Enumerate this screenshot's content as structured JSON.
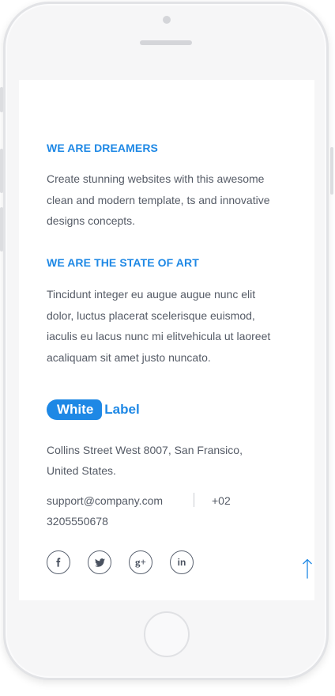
{
  "sections": [
    {
      "heading": "WE ARE DREAMERS",
      "body": "Create stunning websites with this awesome clean and modern template, ts and innovative designs concepts."
    },
    {
      "heading": "WE ARE THE STATE OF ART",
      "body": "Tincidunt integer eu augue augue nunc elit dolor, luctus placerat scelerisque euismod, iaculis eu lacus nunc mi elitvehicula ut laoreet acaliquam sit amet justo nuncato."
    }
  ],
  "brand": {
    "pill_text": "White",
    "label_text": "Label"
  },
  "contact": {
    "address_line1": "Collins Street West 8007, San Fransico,",
    "address_line2": "United States.",
    "email": "support@company.com",
    "phone_prefix": "+02",
    "phone_number": "3205550678"
  },
  "social": [
    {
      "icon": "facebook-icon",
      "glyph": "f"
    },
    {
      "icon": "twitter-icon",
      "glyph": "bird"
    },
    {
      "icon": "google-plus-icon",
      "glyph": "g+"
    },
    {
      "icon": "linkedin-icon",
      "glyph": "in"
    }
  ],
  "colors": {
    "accent": "#1e88e5",
    "text": "#555b66",
    "icon": "#4a5260"
  }
}
